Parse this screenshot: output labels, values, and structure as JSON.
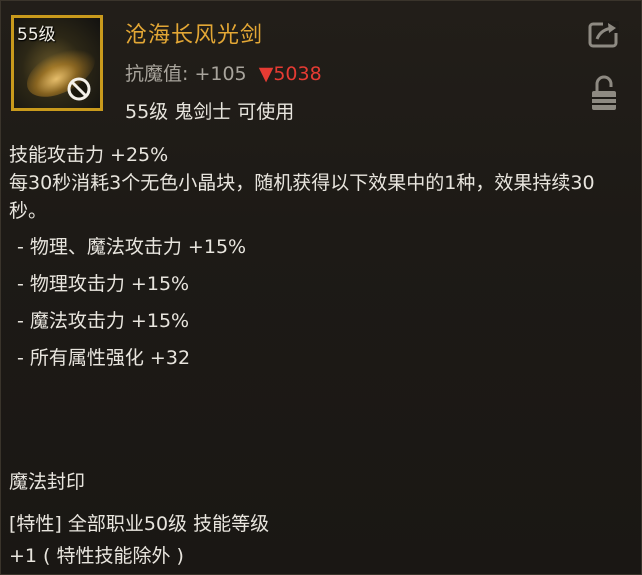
{
  "item": {
    "level_badge": "55级",
    "name": "沧海长风光剑",
    "stat_label": "抗魔值:",
    "stat_value": "+105",
    "stat_diff_arrow": "▼",
    "stat_diff": "5038",
    "requirement": "55级 鬼剑士 可使用"
  },
  "icons": {
    "share": "share-icon",
    "lock": "lock-icon",
    "forbid": "forbid-icon"
  },
  "colors": {
    "name": "#e3a735",
    "diff_negative": "#e53b33",
    "icon_border": "#c99a1c"
  },
  "effects": {
    "skill_attack": "技能攻击力 +25%",
    "description": "每30秒消耗3个无色小晶块，随机获得以下效果中的1种，效果持续30秒。",
    "options": [
      "- 物理、魔法攻击力 +15%",
      "- 物理攻击力 +15%",
      "- 魔法攻击力 +15%",
      "- 所有属性强化 +32"
    ]
  },
  "seal": {
    "title": "魔法封印",
    "trait_line1": "[特性] 全部职业50级 技能等级",
    "trait_line2": "+1 ( 特性技能除外 )"
  }
}
